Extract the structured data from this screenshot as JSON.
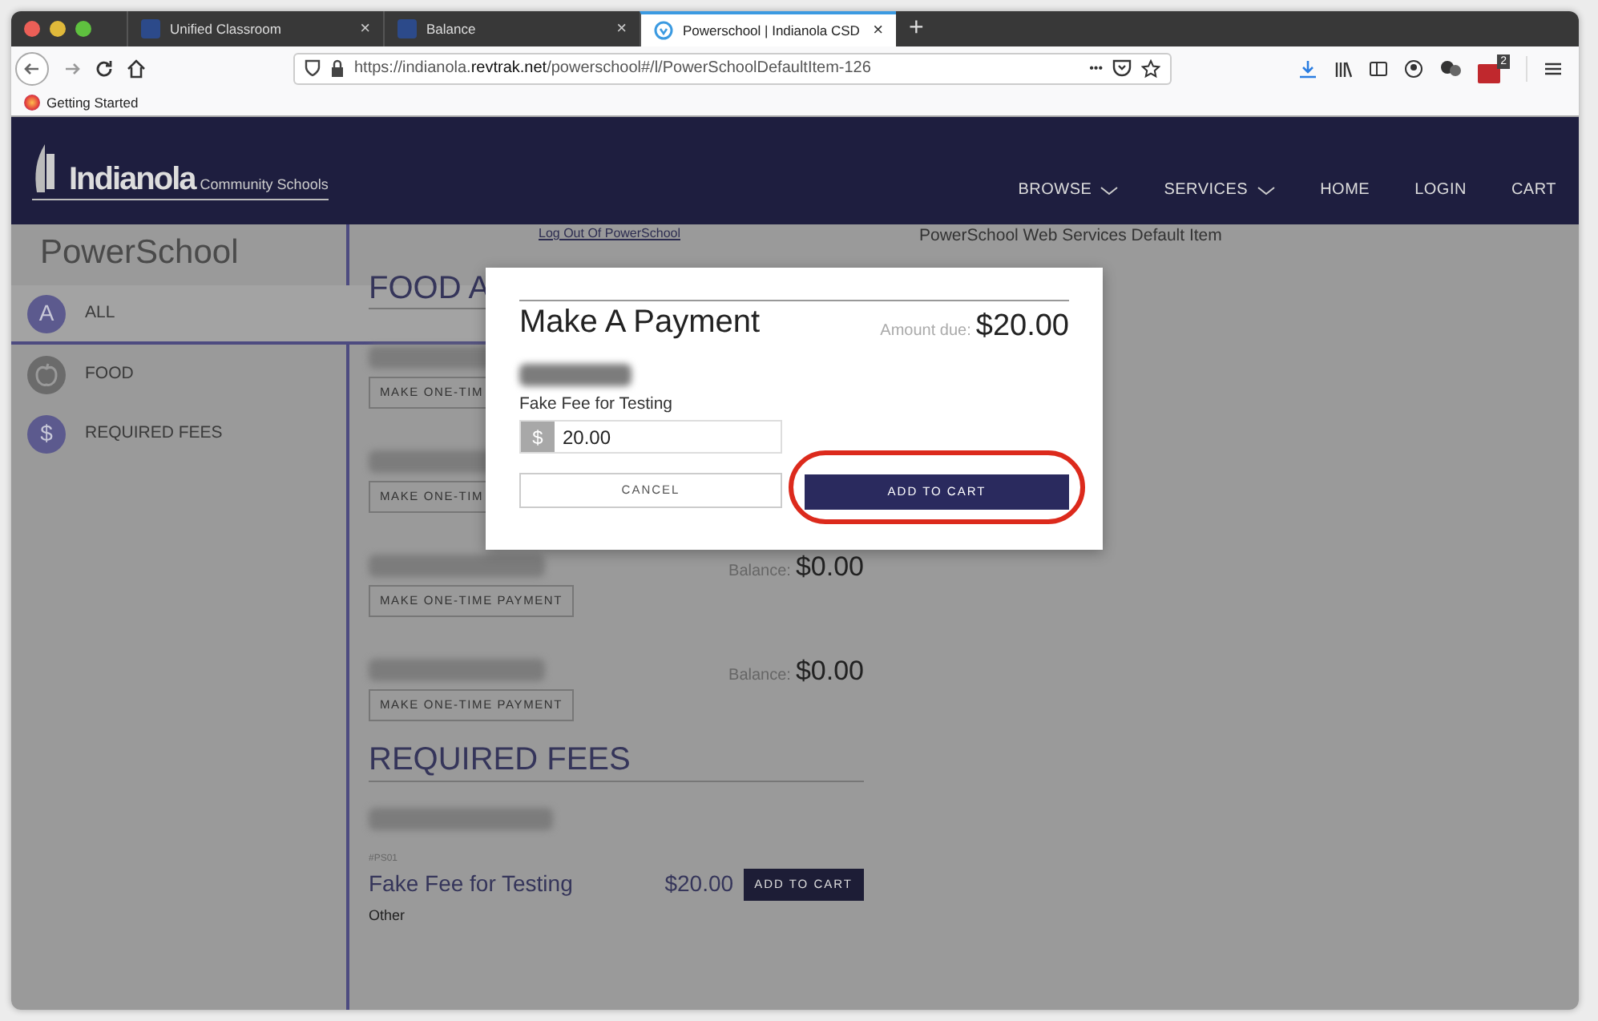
{
  "browser": {
    "tabs": [
      {
        "title": "Unified Classroom",
        "selected": false,
        "close": "×"
      },
      {
        "title": "Balance",
        "selected": false,
        "close": "×"
      },
      {
        "title": "Powerschool | Indianola CSD",
        "selected": true,
        "close": "×"
      }
    ],
    "new_tab": "+",
    "url": "https://indianola.**revtrak.net**/powerschool#/l/PowerSchoolDefaultItem-126",
    "more": "•••",
    "bookmark": "Getting Started",
    "badge_count": "2"
  },
  "site": {
    "logo_name": "Indianola",
    "logo_sub": "Community Schools",
    "nav": [
      {
        "label": "BROWSE",
        "dropdown": true
      },
      {
        "label": "SERVICES",
        "dropdown": true
      },
      {
        "label": "HOME",
        "dropdown": false
      },
      {
        "label": "LOGIN",
        "dropdown": false
      },
      {
        "label": "CART",
        "dropdown": false
      }
    ]
  },
  "sidebar": {
    "title": "PowerSchool",
    "items": [
      {
        "label": "ALL",
        "selected": true,
        "icon": {
          "kind": "letter",
          "text": "A"
        }
      },
      {
        "label": "FOOD",
        "selected": false,
        "icon": {
          "kind": "apple"
        }
      },
      {
        "label": "REQUIRED FEES",
        "selected": false,
        "icon": {
          "kind": "letter",
          "text": "$"
        }
      }
    ]
  },
  "content": {
    "logout_link": "Log Out Of PowerSchool",
    "item_title": "PowerSchool Web Services Default Item",
    "food_heading": "FOOD A",
    "students": [
      {
        "button": "MAKE ONE-TIM"
      },
      {
        "button": "MAKE ONE-TIM"
      },
      {
        "button": "MAKE ONE-TIME PAYMENT",
        "balance_label": "Balance:",
        "balance": "$0.00"
      },
      {
        "button": "MAKE ONE-TIME PAYMENT",
        "balance_label": "Balance:",
        "balance": "$0.00"
      }
    ],
    "fees_heading": "REQUIRED FEES",
    "fee": {
      "code": "#PS01",
      "name": "Fake Fee for Testing",
      "price": "$20.00",
      "button": "ADD TO CART",
      "category": "Other"
    }
  },
  "modal": {
    "title": "Make A Payment",
    "amount_label": "Amount due:",
    "amount": "$20.00",
    "fee_label": "Fake Fee for Testing",
    "currency": "$",
    "value": "20.00",
    "cancel": "CANCEL",
    "confirm": "ADD TO CART",
    "confirm_highlighted": true
  }
}
